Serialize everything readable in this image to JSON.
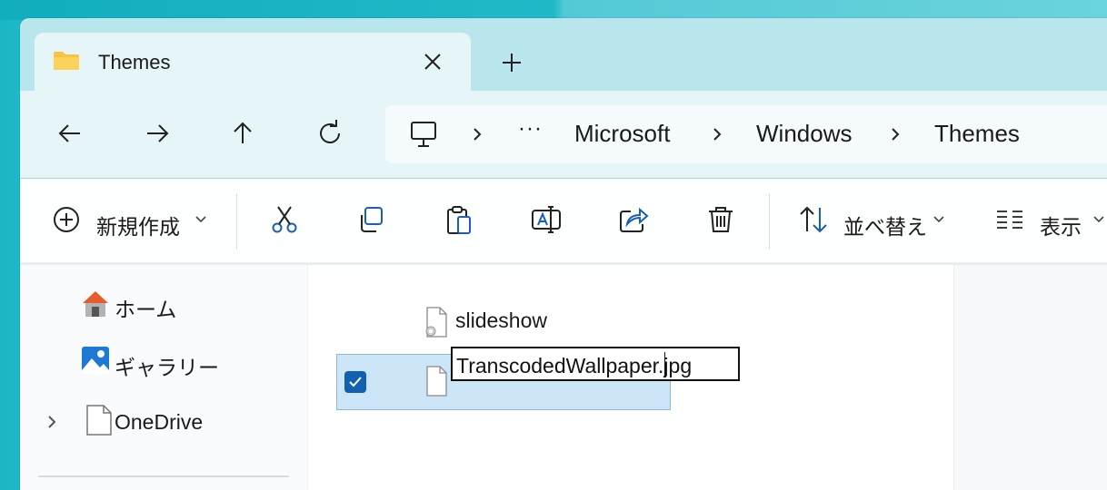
{
  "window": {
    "tab_title": "Themes",
    "new_tab_icon": "plus-icon",
    "tab_icon": "folder-icon"
  },
  "nav": {
    "back_icon": "arrow-left-icon",
    "forward_icon": "arrow-right-icon",
    "up_icon": "arrow-up-icon",
    "refresh_icon": "refresh-icon"
  },
  "address": {
    "root_icon": "this-pc-icon",
    "overflow": "···",
    "crumbs": [
      "Microsoft",
      "Windows",
      "Themes"
    ]
  },
  "toolbar": {
    "new_label": "新規作成",
    "sort_label": "並べ替え",
    "view_label": "表示",
    "actions": [
      "cut-icon",
      "copy-icon",
      "paste-icon",
      "rename-icon",
      "share-icon",
      "delete-icon"
    ]
  },
  "sidebar": {
    "items": [
      {
        "label": "ホーム",
        "icon": "home-icon"
      },
      {
        "label": "ギャラリー",
        "icon": "gallery-icon"
      },
      {
        "label": "OneDrive",
        "icon": "file-icon"
      }
    ]
  },
  "files": [
    {
      "name": "slideshow",
      "icon": "settings-file-icon",
      "selected": false
    },
    {
      "name": "TranscodedWallpaper.jpg",
      "icon": "file-icon",
      "selected": true,
      "renaming": true
    }
  ],
  "colors": {
    "accent": "#1260b0",
    "selection": "#cde6f7",
    "titlebar": "#b9e5ec",
    "navbar": "#e6f5f8"
  }
}
